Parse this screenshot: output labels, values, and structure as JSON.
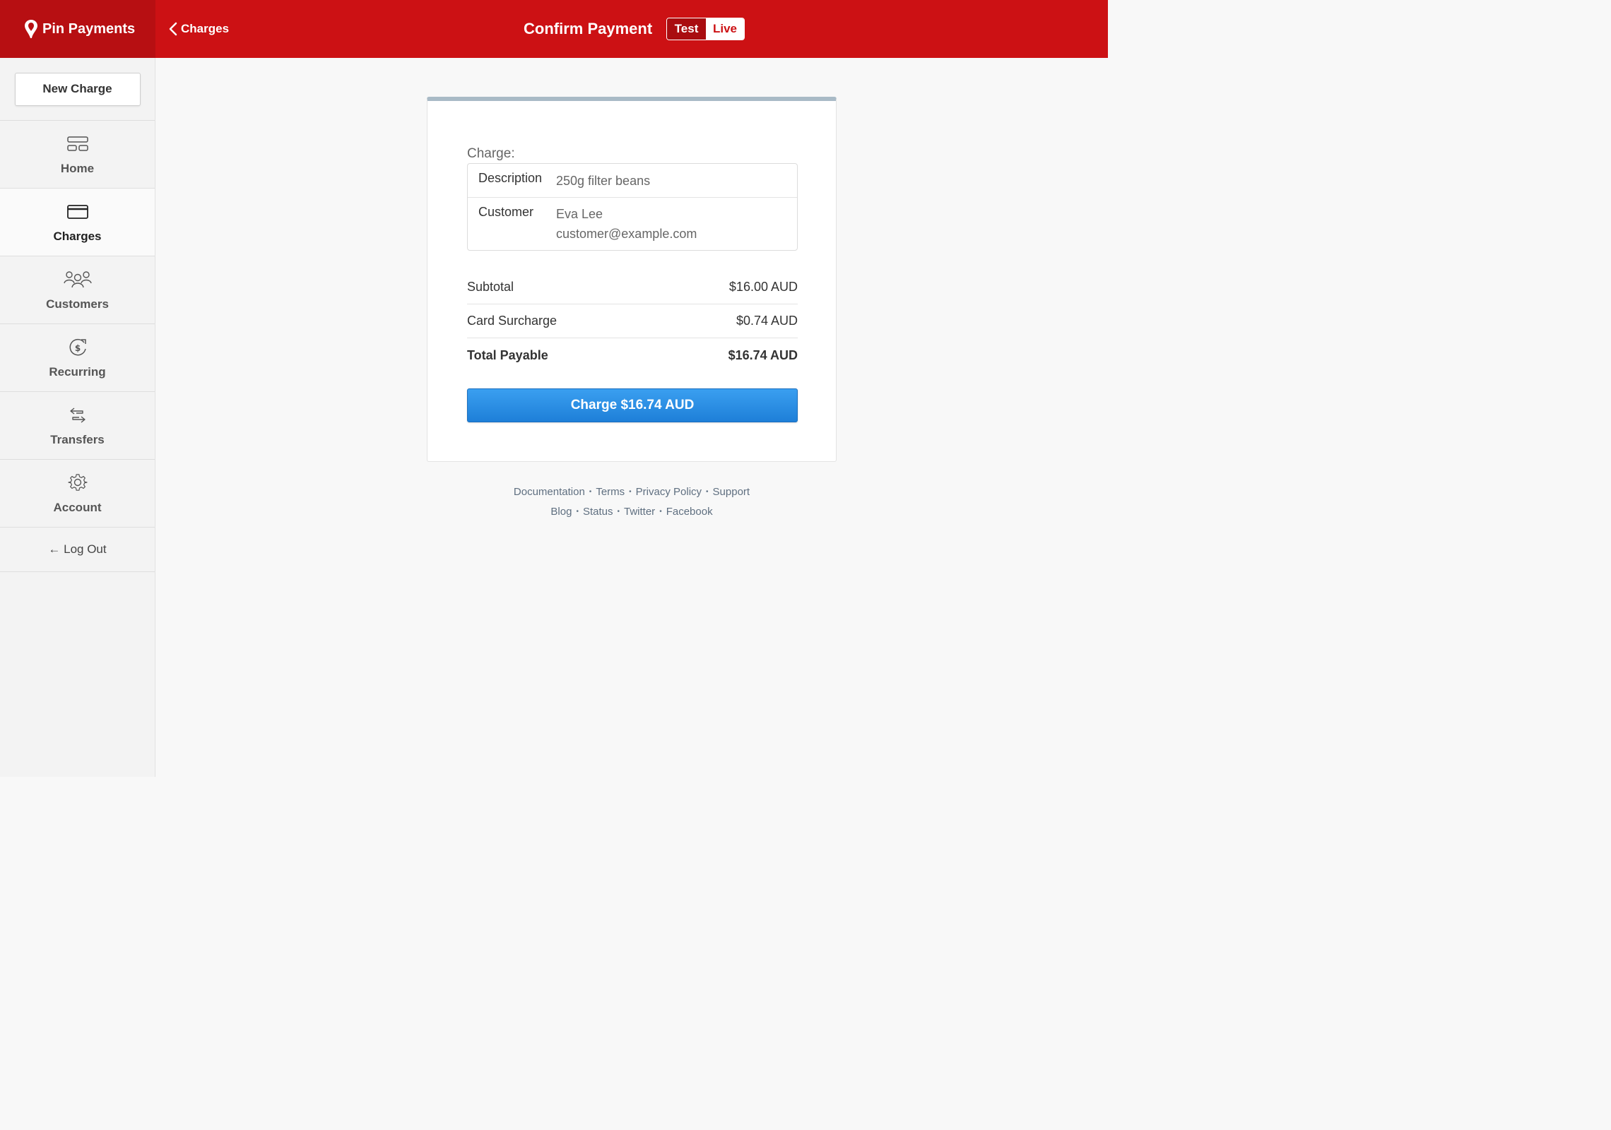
{
  "header": {
    "brand": "Pin Payments",
    "back_label": "Charges",
    "title": "Confirm Payment",
    "mode_test": "Test",
    "mode_live": "Live"
  },
  "sidebar": {
    "new_charge": "New Charge",
    "items": [
      {
        "label": "Home",
        "icon": "home-icon"
      },
      {
        "label": "Charges",
        "icon": "card-icon",
        "active": true
      },
      {
        "label": "Customers",
        "icon": "customers-icon"
      },
      {
        "label": "Recurring",
        "icon": "recurring-icon"
      },
      {
        "label": "Transfers",
        "icon": "transfers-icon"
      },
      {
        "label": "Account",
        "icon": "gear-icon"
      }
    ],
    "logout": "← Log Out"
  },
  "charge": {
    "heading": "Charge:",
    "description_label": "Description",
    "description_value": "250g filter beans",
    "customer_label": "Customer",
    "customer_name": "Eva Lee",
    "customer_email": "customer@example.com"
  },
  "summary": {
    "subtotal_label": "Subtotal",
    "subtotal_value": "$16.00 AUD",
    "surcharge_label": "Card Surcharge",
    "surcharge_value": "$0.74 AUD",
    "total_label": "Total Payable",
    "total_value": "$16.74 AUD"
  },
  "pay_button": "Charge $16.74 AUD",
  "footer": {
    "row1": [
      "Documentation",
      "Terms",
      "Privacy Policy",
      "Support"
    ],
    "row2": [
      "Blog",
      "Status",
      "Twitter",
      "Facebook"
    ]
  },
  "colors": {
    "brand_red": "#cc1114",
    "button_blue": "#2a8fe6"
  }
}
